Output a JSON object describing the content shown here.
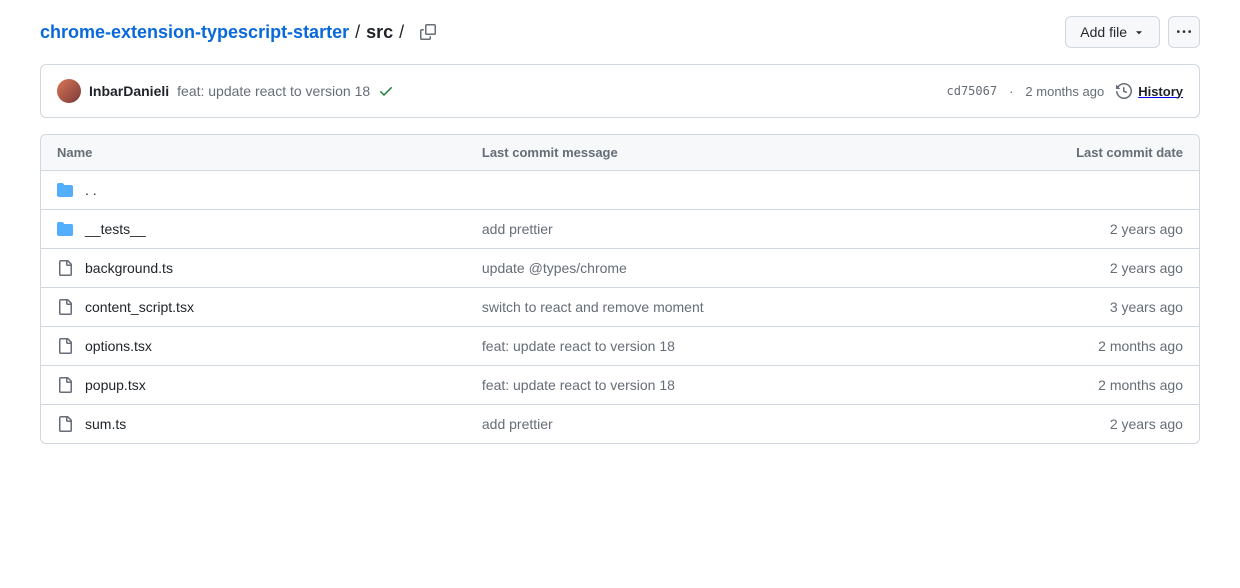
{
  "breadcrumb": {
    "repo": "chrome-extension-typescript-starter",
    "current": "src"
  },
  "actions": {
    "add_file": "Add file"
  },
  "commit": {
    "author": "InbarDanieli",
    "message": "feat: update react to version 18",
    "sha": "cd75067",
    "time": "2 months ago",
    "history_label": "History"
  },
  "table": {
    "headers": {
      "name": "Name",
      "message": "Last commit message",
      "date": "Last commit date"
    }
  },
  "files": [
    {
      "type": "up",
      "name": ". .",
      "message": "",
      "date": ""
    },
    {
      "type": "folder",
      "name": "__tests__",
      "message": "add prettier",
      "date": "2 years ago"
    },
    {
      "type": "file",
      "name": "background.ts",
      "message": "update @types/chrome",
      "date": "2 years ago"
    },
    {
      "type": "file",
      "name": "content_script.tsx",
      "message": "switch to react and remove moment",
      "date": "3 years ago"
    },
    {
      "type": "file",
      "name": "options.tsx",
      "message": "feat: update react to version 18",
      "date": "2 months ago"
    },
    {
      "type": "file",
      "name": "popup.tsx",
      "message": "feat: update react to version 18",
      "date": "2 months ago"
    },
    {
      "type": "file",
      "name": "sum.ts",
      "message": "add prettier",
      "date": "2 years ago"
    }
  ]
}
